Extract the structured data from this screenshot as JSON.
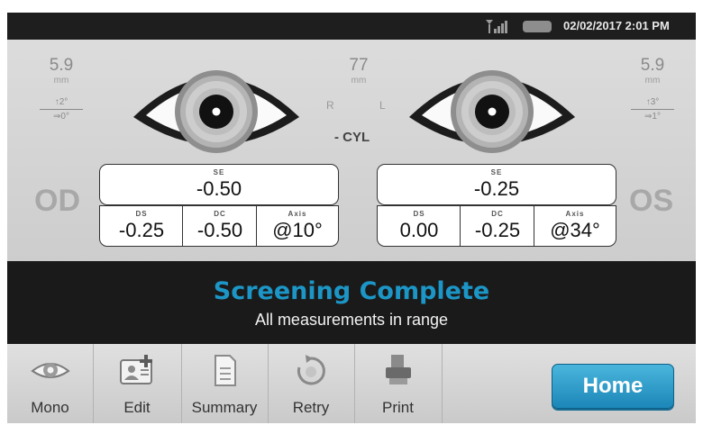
{
  "status_bar": {
    "datetime": "02/02/2017 2:01 PM",
    "icons": [
      "signal-icon",
      "battery-icon"
    ]
  },
  "right_eye": {
    "side_label": "OD",
    "pupil_size": "5.9",
    "pupil_unit": "mm",
    "gaze_vertical": "↑2°",
    "gaze_horizontal": "⇒0°",
    "se_label": "SE",
    "se": "-0.50",
    "ds_label": "DS",
    "ds": "-0.25",
    "dc_label": "DC",
    "dc": "-0.50",
    "axis_label": "Axis",
    "axis": "@10°"
  },
  "left_eye": {
    "side_label": "OS",
    "pupil_size": "5.9",
    "pupil_unit": "mm",
    "gaze_vertical": "↑3°",
    "gaze_horizontal": "⇒1°",
    "se_label": "SE",
    "se": "-0.25",
    "ds_label": "DS",
    "ds": "0.00",
    "dc_label": "DC",
    "dc": "-0.25",
    "axis_label": "Axis",
    "axis": "@34°"
  },
  "center": {
    "pd": "77",
    "pd_unit": "mm",
    "r_label": "R",
    "l_label": "L",
    "cyl_label": "- CYL"
  },
  "banner": {
    "title": "Screening Complete",
    "subtitle": "All measurements in range"
  },
  "toolbar": {
    "items": [
      {
        "label": "Mono",
        "icon": "eye-icon"
      },
      {
        "label": "Edit",
        "icon": "edit-patient-icon"
      },
      {
        "label": "Summary",
        "icon": "document-icon"
      },
      {
        "label": "Retry",
        "icon": "retry-icon"
      },
      {
        "label": "Print",
        "icon": "printer-icon"
      }
    ],
    "home_label": "Home"
  },
  "colors": {
    "accent": "#1c96c6",
    "banner_bg": "#1a1a1a",
    "home_button": "#2a9bcb"
  }
}
